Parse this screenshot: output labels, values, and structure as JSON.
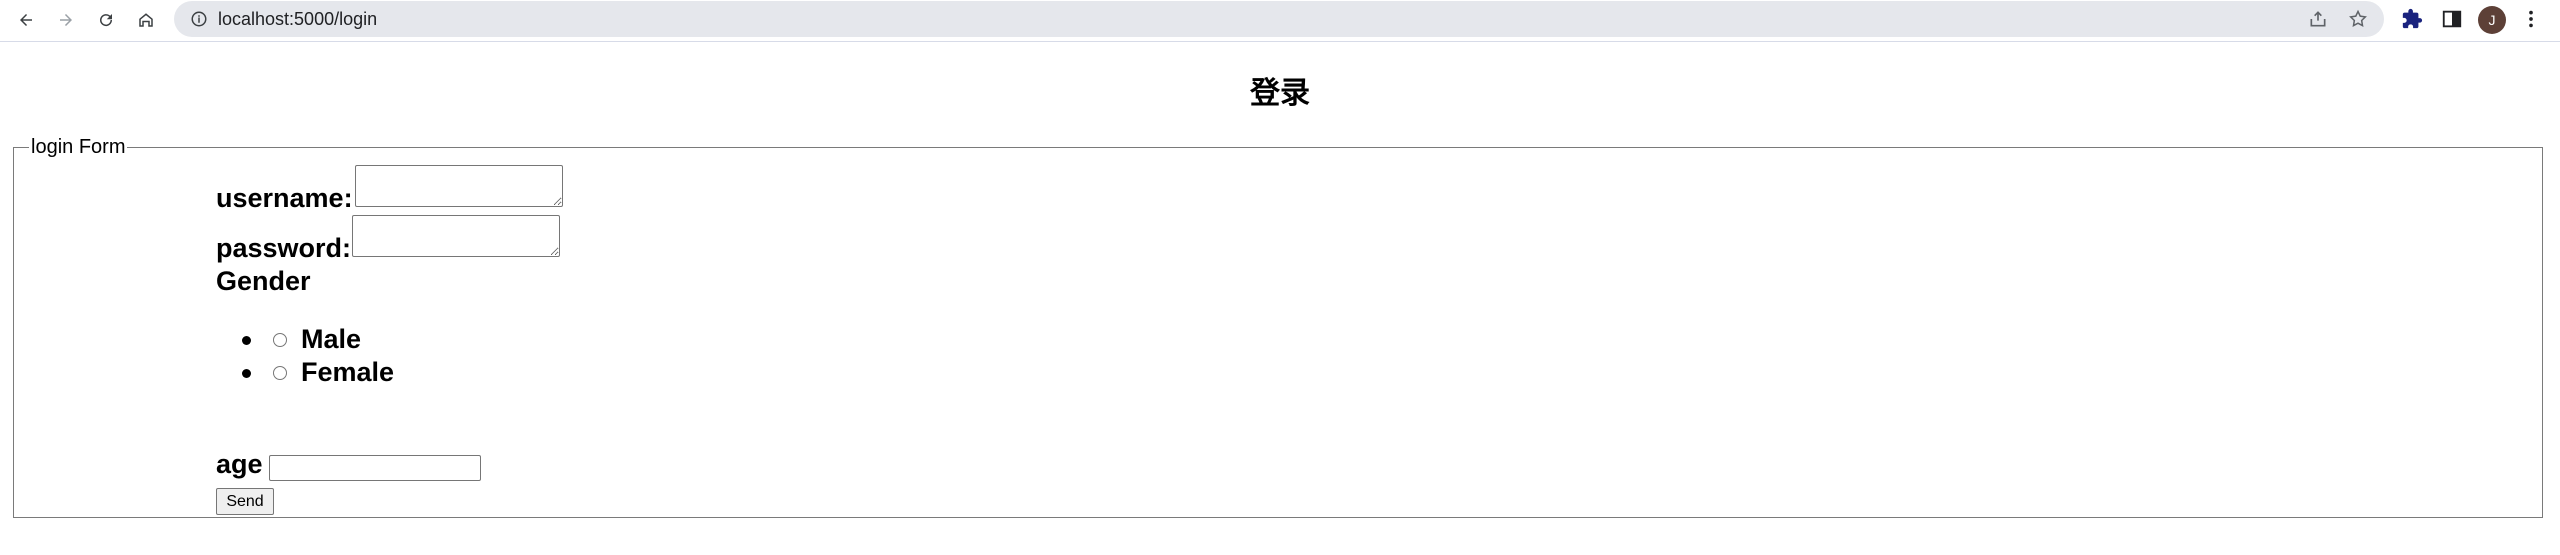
{
  "browser": {
    "url": "localhost:5000/login",
    "avatar_letter": "J",
    "icons": {
      "back": "back-arrow-icon",
      "forward": "forward-arrow-icon",
      "reload": "reload-icon",
      "home": "home-icon",
      "site_info": "info-icon",
      "share": "share-icon",
      "bookmark": "star-icon",
      "extensions": "puzzle-icon",
      "side_panel": "side-panel-icon",
      "menu": "kebab-menu-icon"
    }
  },
  "page": {
    "title": "登录",
    "form": {
      "legend": "login Form",
      "username_label": "username:",
      "password_label": "password:",
      "gender_label": "Gender",
      "gender_options": [
        "Male",
        "Female"
      ],
      "age_label": "age",
      "age_value": "",
      "send_label": "Send"
    }
  }
}
